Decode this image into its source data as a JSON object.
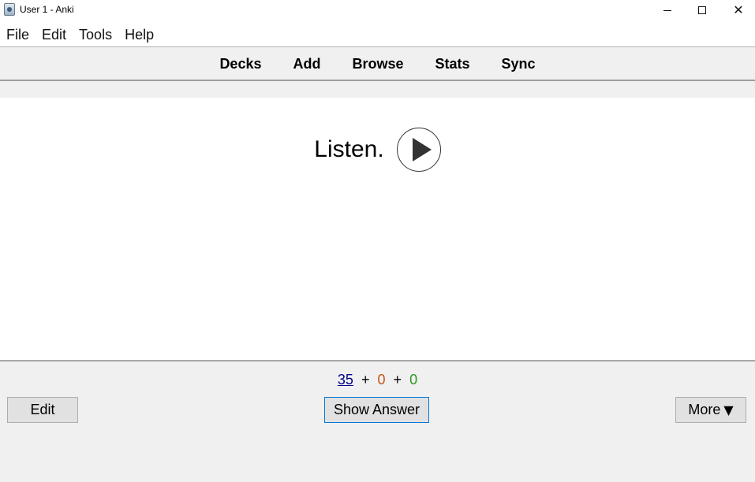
{
  "window": {
    "title": "User 1 - Anki",
    "controls": {
      "minimize": "minimize-icon",
      "maximize": "maximize-icon",
      "close": "✕"
    }
  },
  "menubar": {
    "items": [
      "File",
      "Edit",
      "Tools",
      "Help"
    ]
  },
  "toolbar": {
    "links": [
      "Decks",
      "Add",
      "Browse",
      "Stats",
      "Sync"
    ]
  },
  "card": {
    "question": "Listen.",
    "audio_icon": "play-icon"
  },
  "bottom": {
    "counts": {
      "new": "35",
      "learn": "0",
      "review": "0",
      "separator": "+"
    },
    "colors": {
      "new": "#00008b",
      "learn": "#c35617",
      "review": "#2b9a1f"
    },
    "edit_label": "Edit",
    "show_answer_label": "Show Answer",
    "more_label": "More",
    "more_caret": "▼"
  }
}
